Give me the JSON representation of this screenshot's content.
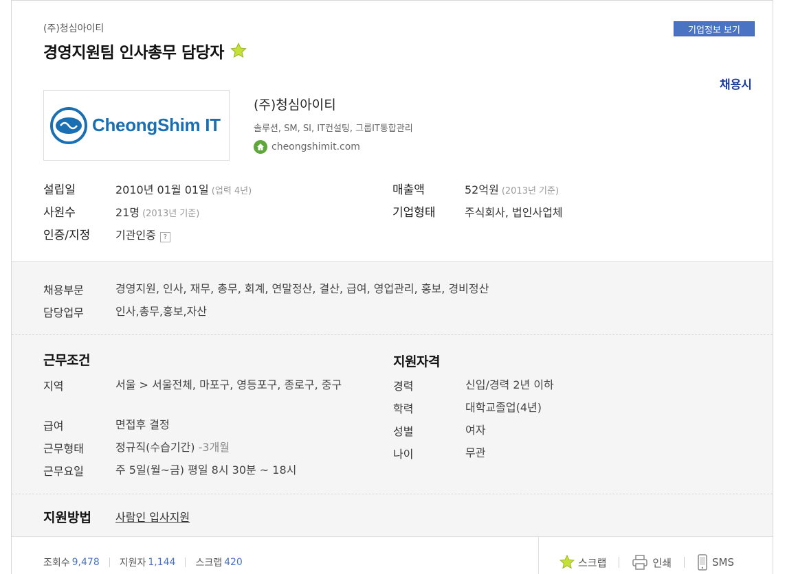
{
  "header": {
    "company_small": "(주)청심아이티",
    "job_title": "경영지원팀 인사총무 담당자",
    "corp_info_button": "기업정보 보기",
    "recruit_link": "채용시"
  },
  "company": {
    "logo_text": "CheongShim IT",
    "name": "(주)청심아이티",
    "description": "솔루션, SM, SI, IT컨설팅, 그룹IT통합관리",
    "homepage": "cheongshimit.com"
  },
  "info": {
    "founded_label": "설립일",
    "founded_value": "2010년 01월 01일",
    "founded_sub": "(업력 4년)",
    "employees_label": "사원수",
    "employees_value": "21명",
    "employees_sub": "(2013년 기준)",
    "cert_label": "인증/지정",
    "cert_value": "기관인증",
    "cert_help": "?",
    "revenue_label": "매출액",
    "revenue_value": "52억원",
    "revenue_sub": "(2013년 기준)",
    "type_label": "기업형태",
    "type_value": "주식회사, 법인사업체"
  },
  "recruit": {
    "dept_label": "채용부문",
    "dept_value": "경영지원, 인사, 재무, 총무, 회계, 연말정산, 결산, 급여, 영업관리, 홍보, 경비정산",
    "duty_label": "담당업무",
    "duty_value": "인사,총무,홍보,자산"
  },
  "conditions": {
    "title": "근무조건",
    "region_label": "지역",
    "region_value": "서울 > 서울전체, 마포구, 영등포구, 종로구, 중구",
    "salary_label": "급여",
    "salary_value": "면접후 결정",
    "worktype_label": "근무형태",
    "worktype_value": "정규직(수습기간)",
    "worktype_sub": "-3개월",
    "workdays_label": "근무요일",
    "workdays_value": "주 5일(월~금) 평일 8시 30분 ~ 18시"
  },
  "qualifications": {
    "title": "지원자격",
    "career_label": "경력",
    "career_value": "신입/경력 2년 이하",
    "edu_label": "학력",
    "edu_value": "대학교졸업(4년)",
    "gender_label": "성별",
    "gender_value": "여자",
    "age_label": "나이",
    "age_value": "무관"
  },
  "apply": {
    "title": "지원방법",
    "method": "사람인 입사지원"
  },
  "stats": {
    "views_label": "조회수",
    "views_value": "9,478",
    "applicants_label": "지원자",
    "applicants_value": "1,144",
    "scraps_label": "스크랩",
    "scraps_value": "420"
  },
  "actions": {
    "scrap": "스크랩",
    "print": "인쇄",
    "sms": "SMS"
  },
  "colors": {
    "accent": "#4a73c4",
    "link_dark": "#1a3a9c",
    "logo_blue": "#1a6fb3",
    "star": "#c6e03a",
    "home_green": "#5ea83b"
  }
}
